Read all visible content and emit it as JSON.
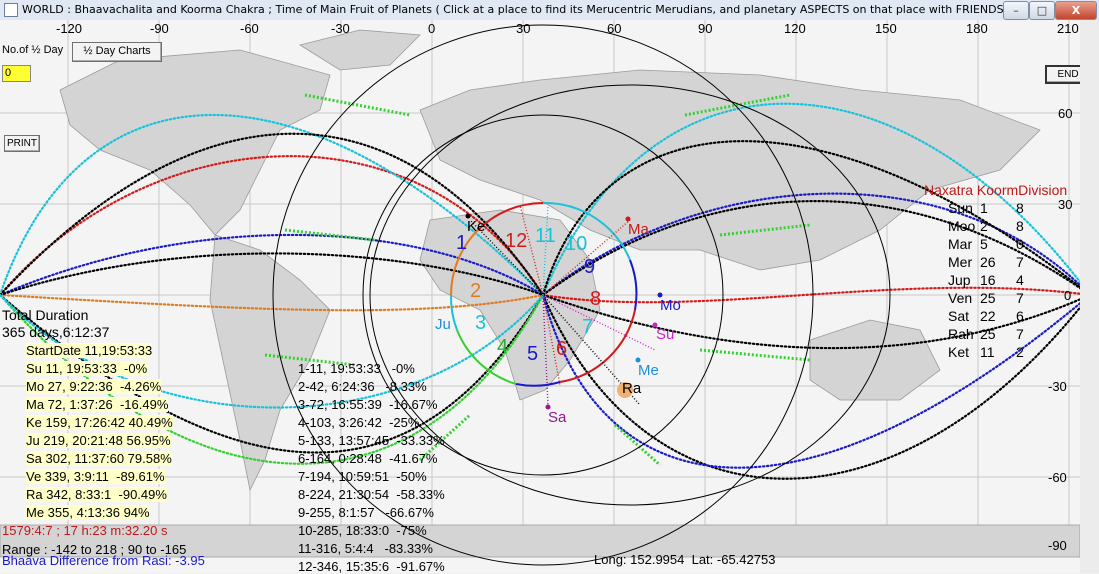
{
  "window": {
    "title": "WORLD  : Bhaavachalita and Koorma Chakra ; Time of Main Fruit of Planets    ( Click at a place to find its Merucentric Merudians, and planetary ASPECTS on that place with FRIENDSHIPS.)",
    "min_label": "–",
    "max_label": "□",
    "close_label": "X"
  },
  "toolbar": {
    "no_of_half_day_label": "No.of ½ Day",
    "half_day_charts_label": "½ Day Charts",
    "half_day_value": "0",
    "print_label": "PRINT",
    "end_label": "END"
  },
  "axes": {
    "lon_ticks": [
      "-120",
      "-90",
      "-60",
      "-30",
      "0",
      "30",
      "60",
      "90",
      "120",
      "150",
      "180",
      "210"
    ],
    "lat_ticks": [
      "60",
      "30",
      "0",
      "-30",
      "-60",
      "-90"
    ]
  },
  "houses": {
    "numbers": [
      "1",
      "2",
      "3",
      "4",
      "5",
      "6",
      "7",
      "8",
      "9",
      "10",
      "11",
      "12"
    ],
    "colors": [
      "#1a1ac8",
      "#e07b20",
      "#18c2d8",
      "#22b52b",
      "#1a1ac8",
      "#d21c1c",
      "#18c2d8",
      "#d21c1c",
      "#1a1ac8",
      "#18c2d8",
      "#18c2d8",
      "#d21c1c"
    ]
  },
  "planets": [
    {
      "name": "Ke",
      "color": "#000000"
    },
    {
      "name": "Ma",
      "color": "#c81b1b"
    },
    {
      "name": "Mo",
      "color": "#1a1ac8"
    },
    {
      "name": "Su",
      "color": "#d020c8"
    },
    {
      "name": "Me",
      "color": "#1f8fd8"
    },
    {
      "name": "Ra",
      "color": "#000000"
    },
    {
      "name": "Sa",
      "color": "#901890"
    },
    {
      "name": "Ju",
      "color": "#1f8fd8"
    }
  ],
  "navatara": {
    "heading": "Naxatra KoormDivision",
    "rows": [
      {
        "planet": "Sun",
        "nak": "1",
        "div": "8"
      },
      {
        "planet": "Moo",
        "nak": "2",
        "div": "8"
      },
      {
        "planet": "Mar",
        "nak": "5",
        "div": "0"
      },
      {
        "planet": "Mer",
        "nak": "26",
        "div": "7"
      },
      {
        "planet": "Jup",
        "nak": "16",
        "div": "4"
      },
      {
        "planet": "Ven",
        "nak": "25",
        "div": "7"
      },
      {
        "planet": "Sat",
        "nak": "22",
        "div": "6"
      },
      {
        "planet": "Rah",
        "nak": "25",
        "div": "7"
      },
      {
        "planet": "Ket",
        "nak": "11",
        "div": "2"
      }
    ]
  },
  "duration": {
    "label": "Total Duration",
    "value": "365 days,6:12:37",
    "start": "StartDate 11,19:53:33"
  },
  "planet_times": [
    "Su 11, 19:53:33  -0%",
    "Mo 27, 9:22:36  -4.26%",
    "Ma 72, 1:37:26  -16.49%",
    "Ke 159, 17:26:42 40.49%",
    "Ju 219, 20:21:48 56.95%",
    "Sa 302, 11:37:60 79.58%",
    "Ve 339, 3:9:11  -89.61%",
    "Ra 342, 8:33:1  -90.49%",
    "Me 355, 4:13:36 94%"
  ],
  "house_times": [
    "1-11, 19:53:33   -0%",
    "2-42, 6:24:36   -8.33%",
    "3-72, 16:55:39  -16.67%",
    "4-103, 3:26:42  -25%",
    "5-133, 13:57:45  -33.33%",
    "6-164, 0:28:48  -41.67%",
    "7-194, 10:59:51  -50%",
    "8-224, 21:30:54  -58.33%",
    "9-255, 8:1:57   -66.67%",
    "10-285, 18:33:0  -75%",
    "11-316, 5:4:4   -83.33%",
    "12-346, 15:35:6  -91.67%"
  ],
  "footer": {
    "time_readout": "1579:4:7 ; 17 h:23 m:32.20 s",
    "range": "Range : -142 to 218 ; 90 to -165",
    "bhaava_diff": "Bhaava Difference from Rasi: -3.95",
    "coords": "Long: 152.9954  Lat: -65.42753"
  },
  "colors": {
    "red": "#d21c1c",
    "blue": "#1a1ac8",
    "cyan": "#18c2d8",
    "green": "#33d12f",
    "orange": "#e07b20",
    "text_red": "#c01818",
    "text_blue": "#1a1ac8",
    "highlight_yellow": "#ffffc8"
  }
}
